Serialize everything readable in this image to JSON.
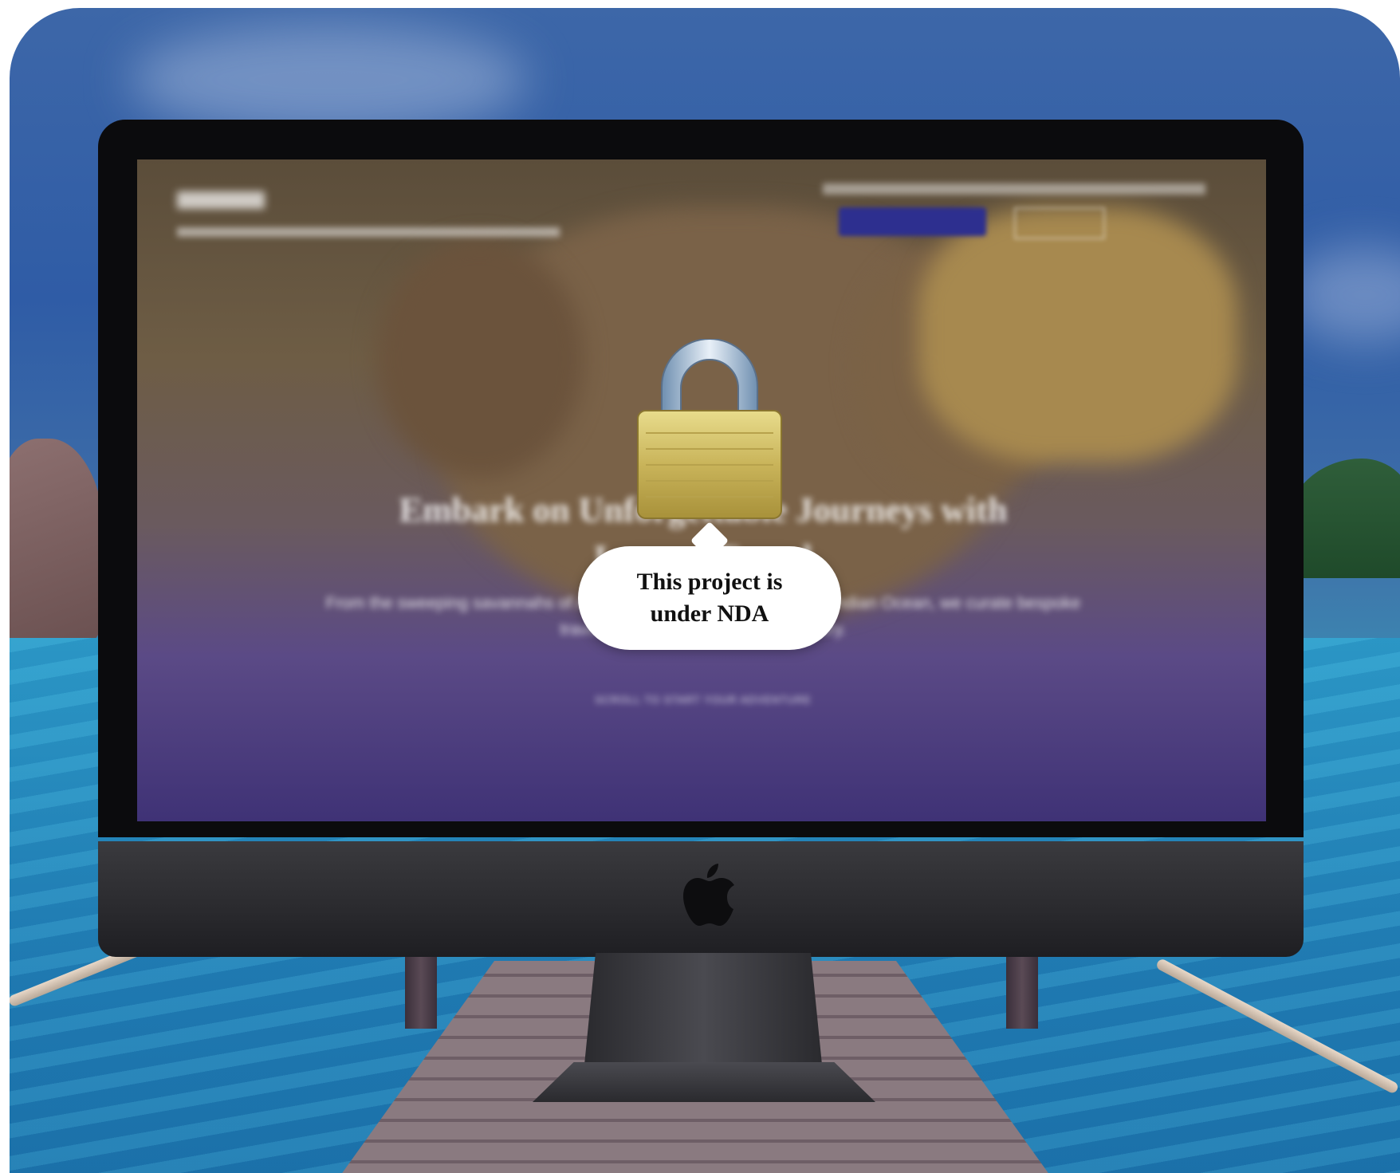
{
  "nda_notice": {
    "message_line1": "This project is",
    "message_line2": "under NDA",
    "icon": "padlock-icon"
  },
  "blurred_site": {
    "headline_line1": "Embark on Unforgettable Journeys with",
    "headline_line2": "Luxury Travel",
    "subtitle": "From the sweeping savannahs of Africa to the tranquil shores of the Indian Ocean, we curate bespoke travel experiences that redefine luxury.",
    "scroll_hint": "SCROLL TO START YOUR ADVENTURE"
  },
  "device": {
    "brand_icon": "apple-logo-icon"
  },
  "colors": {
    "bubble_bg": "#ffffff",
    "bubble_text": "#111111",
    "device_bezel": "#0b0b0d",
    "device_chin": "#2f2f33",
    "sea": "#1f79b0"
  }
}
